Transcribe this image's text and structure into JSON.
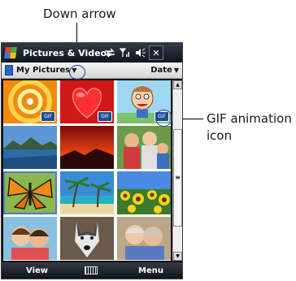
{
  "callouts": {
    "down_arrow": "Down arrow",
    "gif_icon_line1": "GIF animation",
    "gif_icon_line2": "icon"
  },
  "titlebar": {
    "title": "Pictures & Videos",
    "close": "✕",
    "icons": [
      "sync-icon",
      "signal-icon",
      "volume-icon"
    ]
  },
  "folderbar": {
    "folder": "My Pictures",
    "folder_arrow": "▼",
    "sort": "Date",
    "sort_arrow": "▼"
  },
  "thumbnails": [
    {
      "name": "orange-rings",
      "gif": true
    },
    {
      "name": "red-heart",
      "gif": true
    },
    {
      "name": "cartoon-character",
      "gif": true
    },
    {
      "name": "lake-landscape",
      "gif": false
    },
    {
      "name": "red-sunset",
      "gif": false
    },
    {
      "name": "family-photo",
      "gif": false
    },
    {
      "name": "butterfly",
      "gif": false
    },
    {
      "name": "palm-beach",
      "gif": false
    },
    {
      "name": "sunflowers",
      "gif": false
    },
    {
      "name": "kids-portrait",
      "gif": false
    },
    {
      "name": "husky-dog",
      "gif": false
    },
    {
      "name": "elderly-couple",
      "gif": false
    }
  ],
  "gif_badge_text": "GIF",
  "softkeys": {
    "left": "View",
    "right": "Menu"
  }
}
